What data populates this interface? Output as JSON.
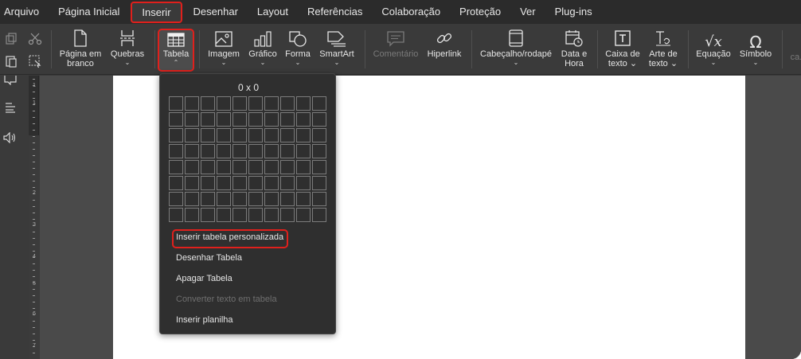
{
  "menubar": {
    "items": [
      {
        "label": "Arquivo"
      },
      {
        "label": "Página Inicial"
      },
      {
        "label": "Inserir"
      },
      {
        "label": "Desenhar"
      },
      {
        "label": "Layout"
      },
      {
        "label": "Referências"
      },
      {
        "label": "Colaboração"
      },
      {
        "label": "Proteção"
      },
      {
        "label": "Ver"
      },
      {
        "label": "Plug-ins"
      }
    ],
    "active": "Inserir"
  },
  "ribbon": {
    "blank_page": {
      "line1": "Página em",
      "line2": "branco"
    },
    "breaks": {
      "label": "Quebras"
    },
    "table": {
      "label": "Tabela"
    },
    "image": {
      "label": "Imagem"
    },
    "chart": {
      "label": "Gráfico"
    },
    "shape": {
      "label": "Forma"
    },
    "smartart": {
      "label": "SmartArt"
    },
    "comment": {
      "label": "Comentário"
    },
    "hyperlink": {
      "label": "Hiperlink"
    },
    "header_footer": {
      "label": "Cabeçalho/rodapé"
    },
    "date_time": {
      "line1": "Data e",
      "line2": "Hora"
    },
    "textbox": {
      "line1": "Caixa de",
      "line2": "texto"
    },
    "textart": {
      "line1": "Arte de",
      "line2": "texto"
    },
    "equation": {
      "label": "Equação"
    },
    "symbol": {
      "label": "Símbolo"
    },
    "cut_off": {
      "label": "ca..."
    }
  },
  "table_dropdown": {
    "grid_size_label": "0 x 0",
    "rows": 8,
    "cols": 10,
    "items": {
      "custom": "Inserir tabela personalizada",
      "draw": "Desenhar Tabela",
      "erase": "Apagar Tabela",
      "convert": "Converter texto em tabela",
      "spreadsheet": "Inserir planilha"
    }
  },
  "ruler": {
    "numbers": [
      "1",
      "1",
      "2",
      "3",
      "4",
      "5",
      "6",
      "7"
    ]
  },
  "colors": {
    "accent_highlight": "#e0201c",
    "toolbar_bg": "#3a3a3a",
    "menubar_bg": "#2b2b2b",
    "page_bg": "#ffffff"
  }
}
